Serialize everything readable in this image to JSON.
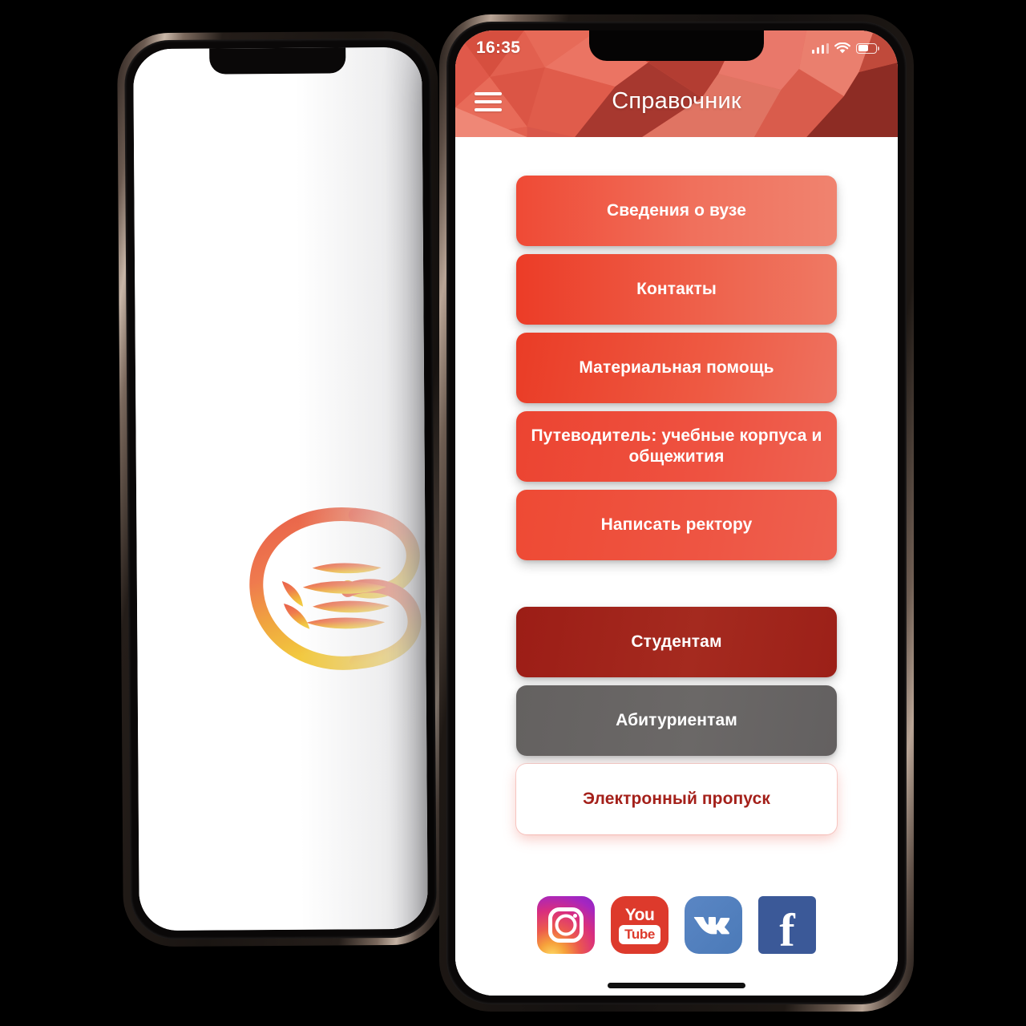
{
  "app": {
    "title": "Справочник",
    "status": {
      "time": "16:35",
      "signal_icon": "cellular-signal-icon",
      "wifi_icon": "wifi-icon",
      "battery_icon": "battery-icon"
    },
    "menu_icon": "hamburger-menu-icon",
    "accent_color": "#ee4a35",
    "dark_button_color": "#9c2018",
    "gray_button_color": "#646160",
    "outline_text_color": "#a4201a"
  },
  "menu": {
    "primary": [
      {
        "label": "Сведения о вузе",
        "style": "grad-a"
      },
      {
        "label": "Контакты",
        "style": "grad-b"
      },
      {
        "label": "Материальная помощь",
        "style": "grad-c"
      },
      {
        "label": "Путеводитель: учебные корпуса и общежития",
        "style": "grad-d"
      },
      {
        "label": "Написать ректору",
        "style": "grad-e"
      }
    ],
    "secondary": [
      {
        "label": "Студентам",
        "style": "dark"
      },
      {
        "label": "Абитуриентам",
        "style": "gray"
      },
      {
        "label": "Электронный пропуск",
        "style": "white"
      }
    ]
  },
  "socials": [
    {
      "name": "instagram",
      "label": "Instagram"
    },
    {
      "name": "youtube",
      "label_top": "You",
      "label_bottom": "Tube"
    },
    {
      "name": "vk",
      "label": "VK"
    },
    {
      "name": "facebook",
      "label": "f"
    }
  ],
  "splash": {
    "logo_name": "university-logo",
    "background": "#ffffff"
  }
}
